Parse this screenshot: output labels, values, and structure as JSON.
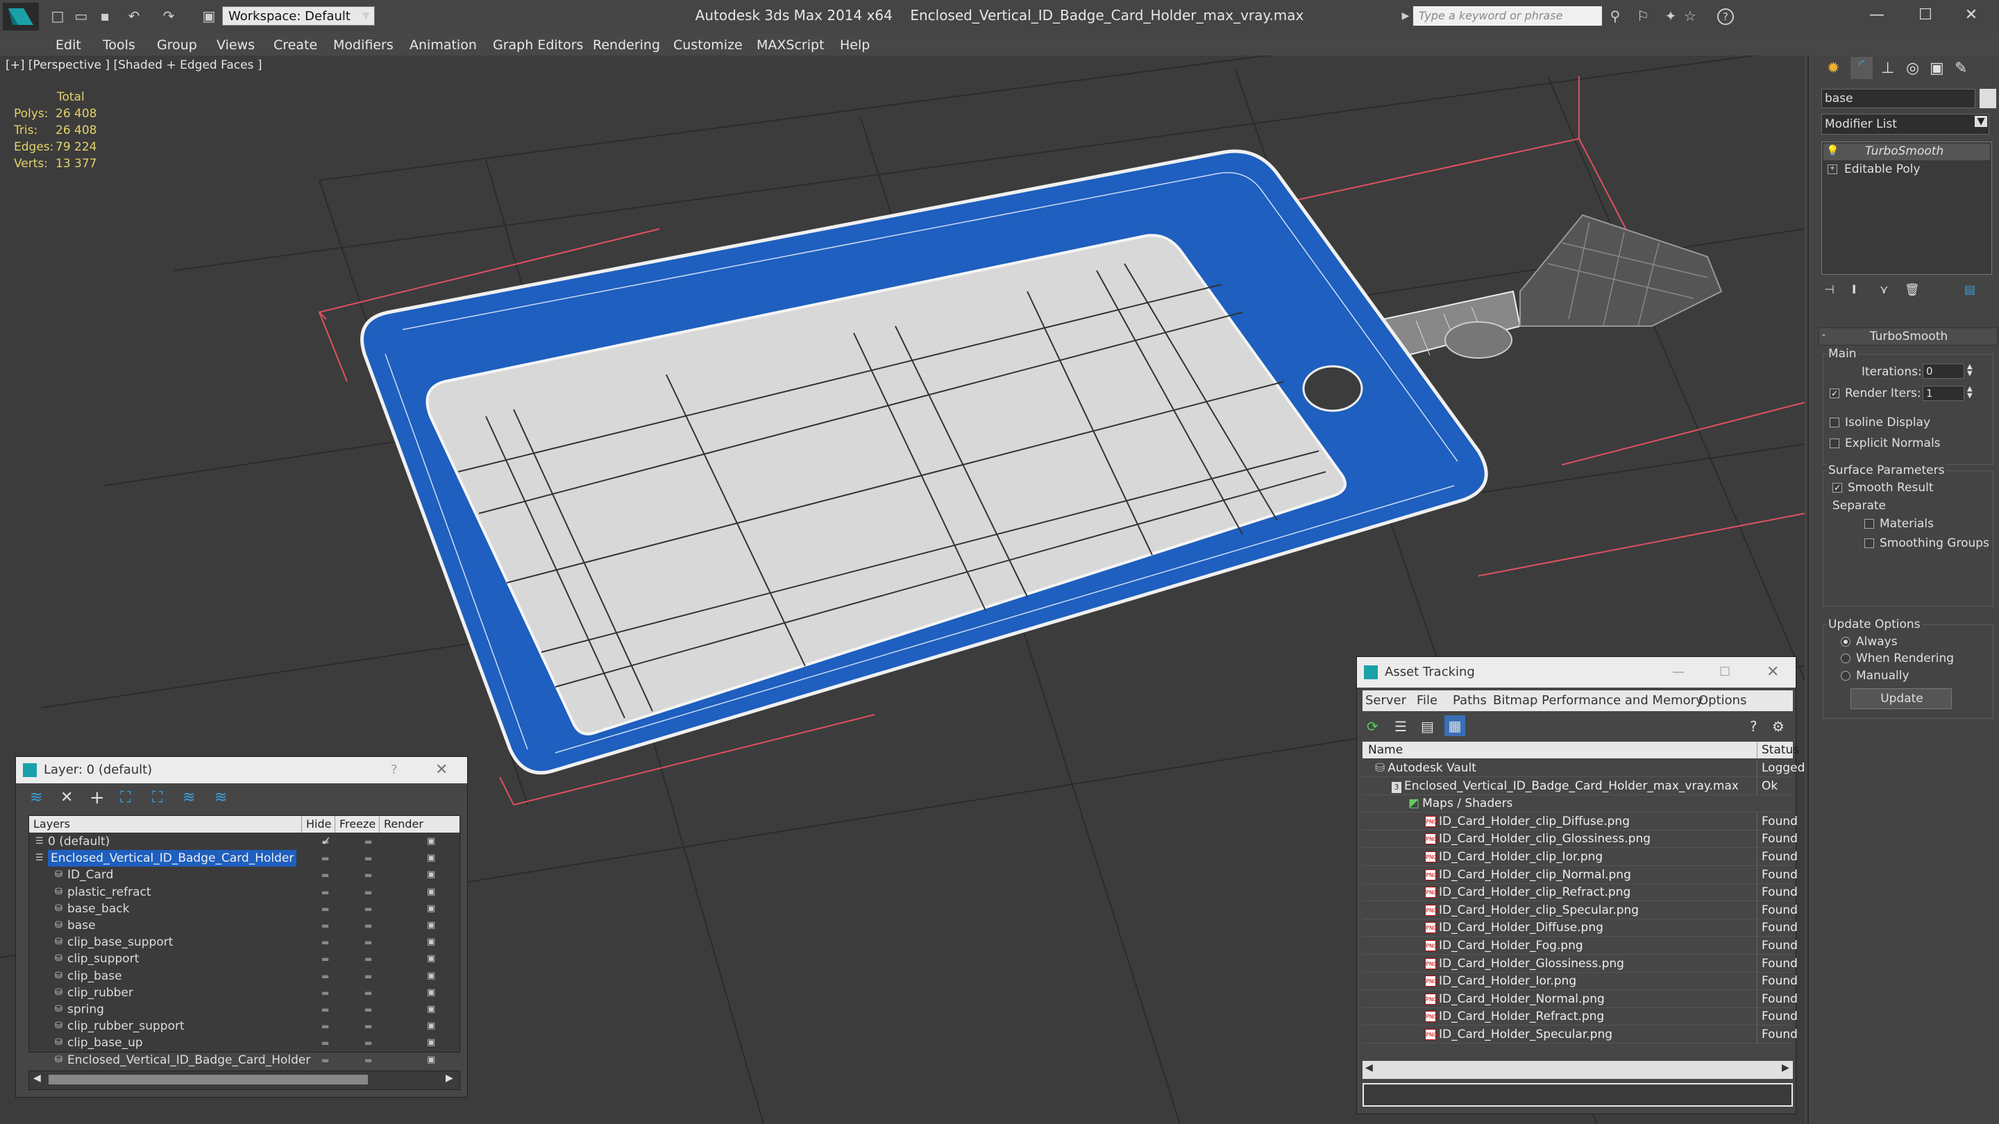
{
  "titlebar": {
    "app": "Autodesk 3ds Max  2014 x64",
    "file": "Enclosed_Vertical_ID_Badge_Card_Holder_max_vray.max",
    "workspace": "Workspace: Default",
    "search_placeholder": "Type a keyword or phrase"
  },
  "menu": [
    "Edit",
    "Tools",
    "Group",
    "Views",
    "Create",
    "Modifiers",
    "Animation",
    "Graph Editors",
    "Rendering",
    "Customize",
    "MAXScript",
    "Help"
  ],
  "viewport": {
    "label": "[+] [Perspective ] [Shaded + Edged Faces ]",
    "stats_header": "Total",
    "stats": [
      {
        "k": "Polys:",
        "v": "26 408"
      },
      {
        "k": "Tris:",
        "v": "26 408"
      },
      {
        "k": "Edges:",
        "v": "79 224"
      },
      {
        "k": "Verts:",
        "v": "13 377"
      }
    ]
  },
  "command_panel": {
    "object_name": "base",
    "modifier_list": "Modifier List",
    "stack": [
      "TurboSmooth",
      "Editable Poly"
    ],
    "rollout_title": "TurboSmooth",
    "main": "Main",
    "iterations_label": "Iterations:",
    "iterations_value": "0",
    "render_iters_label": "Render Iters:",
    "render_iters_value": "1",
    "isoline": "Isoline Display",
    "explicit": "Explicit Normals",
    "surface_params": "Surface Parameters",
    "smooth_result": "Smooth Result",
    "separate": "Separate",
    "materials": "Materials",
    "smoothing_groups": "Smoothing Groups",
    "update_options": "Update Options",
    "always": "Always",
    "when_rendering": "When Rendering",
    "manually": "Manually",
    "update_btn": "Update"
  },
  "layer_panel": {
    "title": "Layer: 0 (default)",
    "help": "?",
    "columns": {
      "layers": "Layers",
      "hide": "Hide",
      "freeze": "Freeze",
      "render": "Render"
    },
    "rows": [
      {
        "name": "0 (default)",
        "level": 0
      },
      {
        "name": "Enclosed_Vertical_ID_Badge_Card_Holder",
        "level": 0,
        "selected": true
      },
      {
        "name": "ID_Card",
        "level": 1
      },
      {
        "name": "plastic_refract",
        "level": 1
      },
      {
        "name": "base_back",
        "level": 1
      },
      {
        "name": "base",
        "level": 1
      },
      {
        "name": "clip_base_support",
        "level": 1
      },
      {
        "name": "clip_support",
        "level": 1
      },
      {
        "name": "clip_base",
        "level": 1
      },
      {
        "name": "clip_rubber",
        "level": 1
      },
      {
        "name": "spring",
        "level": 1
      },
      {
        "name": "clip_rubber_support",
        "level": 1
      },
      {
        "name": "clip_base_up",
        "level": 1
      },
      {
        "name": "Enclosed_Vertical_ID_Badge_Card_Holder",
        "level": 1
      }
    ]
  },
  "asset_panel": {
    "title": "Asset Tracking",
    "menu": [
      "Server",
      "File",
      "Paths",
      "Bitmap Performance and Memory",
      "Options"
    ],
    "col_name": "Name",
    "col_status": "Status",
    "rows": [
      {
        "name": "Autodesk Vault",
        "status": "Logged",
        "level": 0
      },
      {
        "name": "Enclosed_Vertical_ID_Badge_Card_Holder_max_vray.max",
        "status": "Ok",
        "level": 1
      },
      {
        "name": "Maps / Shaders",
        "status": "",
        "level": 2
      },
      {
        "name": "ID_Card_Holder_clip_Diffuse.png",
        "status": "Found",
        "level": 3
      },
      {
        "name": "ID_Card_Holder_clip_Glossiness.png",
        "status": "Found",
        "level": 3
      },
      {
        "name": "ID_Card_Holder_clip_Ior.png",
        "status": "Found",
        "level": 3
      },
      {
        "name": "ID_Card_Holder_clip_Normal.png",
        "status": "Found",
        "level": 3
      },
      {
        "name": "ID_Card_Holder_clip_Refract.png",
        "status": "Found",
        "level": 3
      },
      {
        "name": "ID_Card_Holder_clip_Specular.png",
        "status": "Found",
        "level": 3
      },
      {
        "name": "ID_Card_Holder_Diffuse.png",
        "status": "Found",
        "level": 3
      },
      {
        "name": "ID_Card_Holder_Fog.png",
        "status": "Found",
        "level": 3
      },
      {
        "name": "ID_Card_Holder_Glossiness.png",
        "status": "Found",
        "level": 3
      },
      {
        "name": "ID_Card_Holder_Ior.png",
        "status": "Found",
        "level": 3
      },
      {
        "name": "ID_Card_Holder_Normal.png",
        "status": "Found",
        "level": 3
      },
      {
        "name": "ID_Card_Holder_Refract.png",
        "status": "Found",
        "level": 3
      },
      {
        "name": "ID_Card_Holder_Specular.png",
        "status": "Found",
        "level": 3
      }
    ]
  },
  "colors": {
    "selection_blue": "#1e5fbf",
    "stats_yellow": "#e3d36a",
    "card_inner": "#d8d8d8"
  }
}
